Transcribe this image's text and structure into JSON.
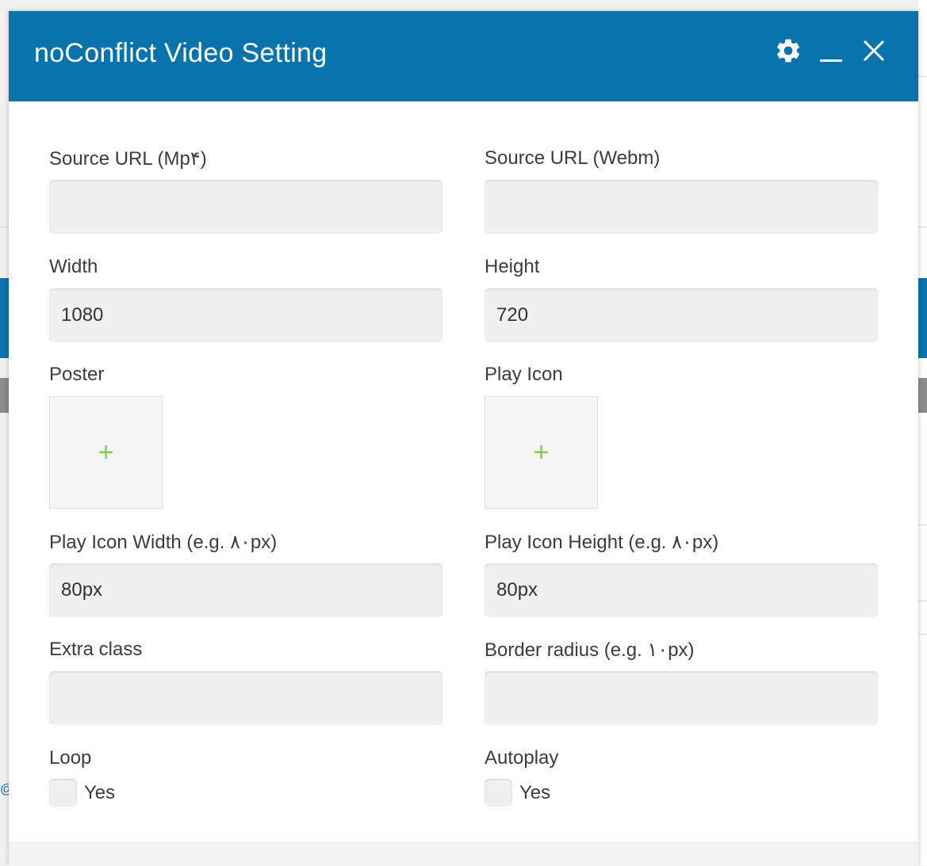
{
  "dialog": {
    "title": "noConflict Video Setting",
    "header_icons": [
      "gear-icon",
      "minimize-icon",
      "close-icon"
    ]
  },
  "fields": {
    "source_mp4": {
      "label": "Source URL (Mp۴)",
      "value": "",
      "placeholder": ""
    },
    "source_webm": {
      "label": "Source URL (Webm)",
      "value": "",
      "placeholder": ""
    },
    "width": {
      "label": "Width",
      "value": "1080"
    },
    "height": {
      "label": "Height",
      "value": "720"
    },
    "poster": {
      "label": "Poster",
      "add_symbol": "+"
    },
    "play_icon": {
      "label": "Play Icon",
      "add_symbol": "+"
    },
    "play_icon_width": {
      "label": "Play Icon Width (e.g. ۸۰px)",
      "value": "80px"
    },
    "play_icon_height": {
      "label": "Play Icon Height (e.g. ۸۰px)",
      "value": "80px"
    },
    "extra_class": {
      "label": "Extra class",
      "value": ""
    },
    "border_radius": {
      "label": "Border radius (e.g. ۱۰px)",
      "value": ""
    },
    "loop": {
      "label": "Loop",
      "option_label": "Yes",
      "checked": false
    },
    "autoplay": {
      "label": "Autoplay",
      "option_label": "Yes",
      "checked": false
    }
  },
  "background": {
    "partial_text": "@"
  },
  "colors": {
    "header": "#0673ac",
    "plus": "#7fcf4f",
    "label": "#3c3c3c",
    "input_bg": "#f0f0f0"
  }
}
